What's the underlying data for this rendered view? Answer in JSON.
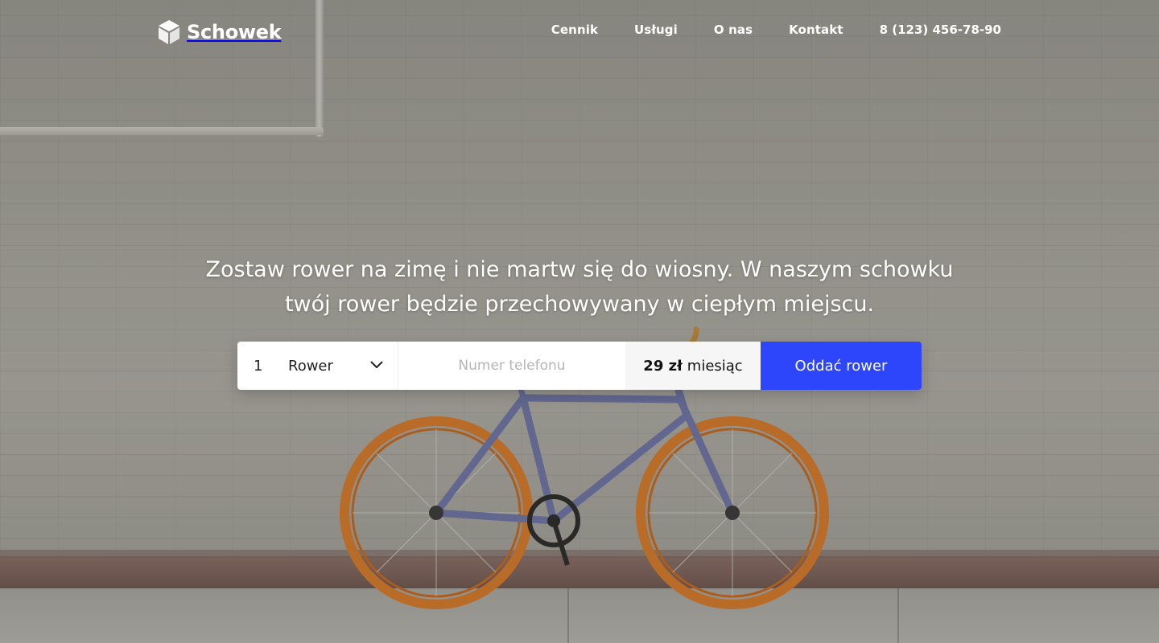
{
  "brand": {
    "name": "Schowek",
    "logo_icon": "box-icon"
  },
  "nav": {
    "items": [
      {
        "label": "Cennik"
      },
      {
        "label": "Usługi"
      },
      {
        "label": "O nas"
      },
      {
        "label": "Kontakt"
      }
    ],
    "phone": "8 (123) 456-78-90"
  },
  "hero": {
    "line1": "Zostaw rower na zimę i nie martw się do wiosny. W naszym schowku",
    "line2": "twój rower będzie przechowywany w ciepłym miejscu."
  },
  "form": {
    "quantity": "1",
    "unit": "Rower",
    "dropdown_icon": "chevron-down-icon",
    "phone_placeholder": "Numer telefonu",
    "price_amount": "29 zł",
    "price_period": "miesiąc",
    "submit_label": "Oddać rower",
    "accent_color": "#2d45fb"
  },
  "background": {
    "subject": "bicycle-with-orange-wheels"
  }
}
